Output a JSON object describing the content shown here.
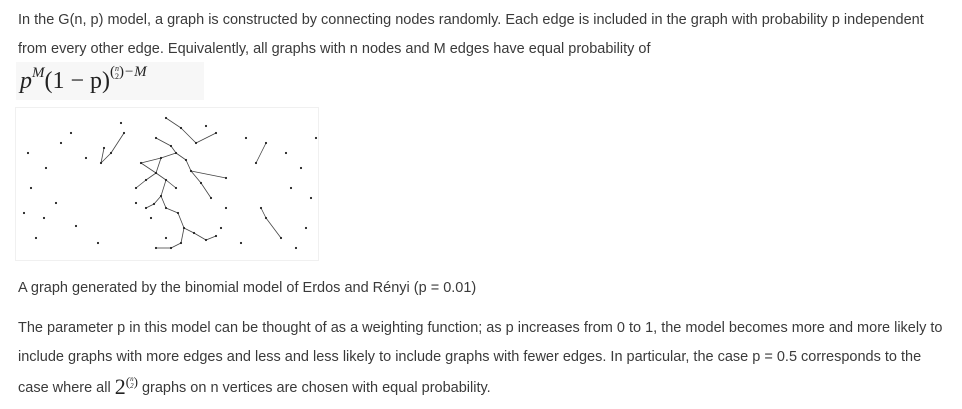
{
  "intro": {
    "text": "In the G(n, p) model, a graph is constructed by connecting nodes randomly. Each edge is included in the graph with probability p independent from every other edge. Equivalently, all graphs with n nodes and M edges have equal probability of"
  },
  "formula": {
    "p": "p",
    "exp_M": "M",
    "middle": "(1 − p)",
    "binom_top": "n",
    "binom_bottom": "2",
    "minus_M": "−M"
  },
  "figure": {
    "alt": "random graph",
    "caption": "A graph generated by the binomial model of Erdos and Rényi (p = 0.01)"
  },
  "paragraph2": {
    "before": "The parameter p in this model can be thought of as a weighting function; as p increases from 0 to 1, the model becomes more and more likely to include graphs with more edges and less and less likely to include graphs with fewer edges. In particular, the case p = 0.5 corresponds to the case where all",
    "math_base": "2",
    "binom_top": "n",
    "binom_bottom": "2",
    "after": "graphs on n vertices are chosen with equal probability."
  },
  "colors": {
    "text": "#3a3a3a",
    "formula_bg": "#f7f7f7",
    "node": "#222222"
  }
}
